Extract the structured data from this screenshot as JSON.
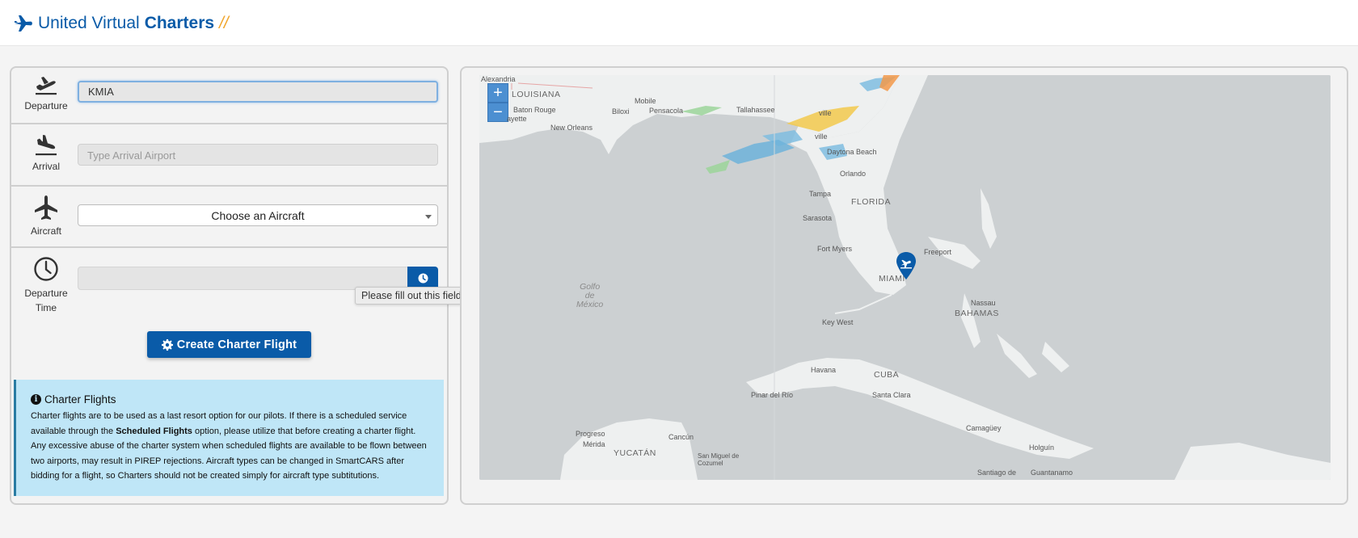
{
  "header": {
    "brand_light": "United Virtual",
    "brand_bold": "Charters",
    "brand_slashes": "//"
  },
  "form": {
    "departure": {
      "label": "Departure",
      "value": "KMIA"
    },
    "arrival": {
      "label": "Arrival",
      "placeholder": "Type Arrival Airport"
    },
    "aircraft": {
      "label": "Aircraft",
      "selected": "Choose an Aircraft"
    },
    "departure_time": {
      "label_line1": "Departure",
      "label_line2": "Time",
      "tooltip": "Please fill out this field."
    },
    "create_button": "Create Charter Flight"
  },
  "info": {
    "title": "Charter Flights",
    "text_before": "Charter flights are to be used as a last resort option for our pilots. If there is a scheduled service available through the ",
    "text_bold": "Scheduled Flights",
    "text_after": " option, please utilize that before creating a charter flight. Any excessive abuse of the charter system when scheduled flights are available to be flown between two airports, may result in PIREP rejections. Aircraft types can be changed in SmartCARS after bidding for a flight, so Charters should not be created simply for aircraft type subtitutions."
  },
  "map": {
    "zoom_in": "+",
    "zoom_out": "−",
    "labels": {
      "alexandria": "Alexandria",
      "louisiana": "LOUISIANA",
      "baton_rouge": "Baton Rouge",
      "lafayette": "ayette",
      "new_orleans": "New Orleans",
      "mobile": "Mobile",
      "biloxi": "Biloxi",
      "pensacola": "Pensacola",
      "tallahassee": "Tallahassee",
      "jacksonville": "ville",
      "gainesville": "ville",
      "daytona": "Daytona Beach",
      "orlando": "Orlando",
      "tampa": "Tampa",
      "florida": "FLORIDA",
      "sarasota": "Sarasota",
      "fort_myers": "Fort Myers",
      "freeport": "Freeport",
      "miami": "MIAMI",
      "nassau": "Nassau",
      "bahamas": "BAHAMAS",
      "key_west": "Key West",
      "golfo": "Golfo\nde\nMéxico",
      "havana": "Havana",
      "cuba": "CUBA",
      "pinar": "Pinar del Río",
      "santa_clara": "Santa Clara",
      "camaguey": "Camagüey",
      "holguin": "Holguín",
      "santiago": "Santiago de",
      "guantanamo": "Guantanamo",
      "progreso": "Progreso",
      "merida": "Mérida",
      "cancun": "Cancún",
      "yucatan": "YUCATÁN",
      "san_miguel": "San Miguel de\nCozumel"
    }
  },
  "colors": {
    "brand_blue": "#0a5ba8",
    "accent_orange": "#f0a52b",
    "info_bg": "#bfe6f7"
  }
}
